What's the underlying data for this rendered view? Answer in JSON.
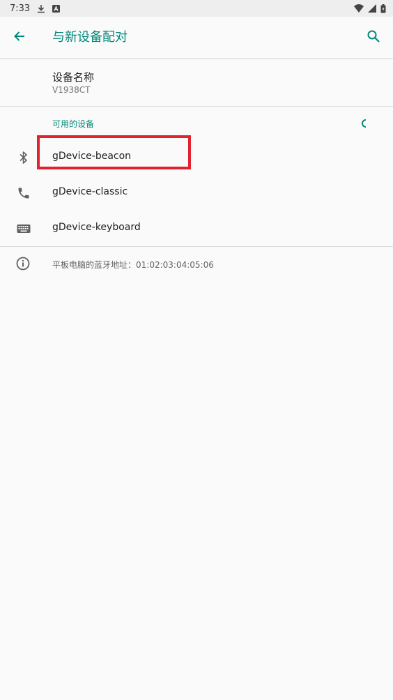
{
  "status_bar": {
    "time": "7:33"
  },
  "app_bar": {
    "title": "与新设备配对"
  },
  "device_name": {
    "title": "设备名称",
    "value": "V1938CT"
  },
  "available_devices": {
    "label": "可用的设备",
    "items": [
      {
        "label": "gDevice-beacon",
        "icon": "bluetooth-icon"
      },
      {
        "label": "gDevice-classic",
        "icon": "phone-icon"
      },
      {
        "label": "gDevice-keyboard",
        "icon": "keyboard-icon"
      }
    ]
  },
  "info": {
    "text": "平板电脑的蓝牙地址：01:02:03:04:05:06"
  },
  "colors": {
    "accent": "#00897b",
    "highlight": "#e0232e",
    "background": "#fafafa"
  }
}
